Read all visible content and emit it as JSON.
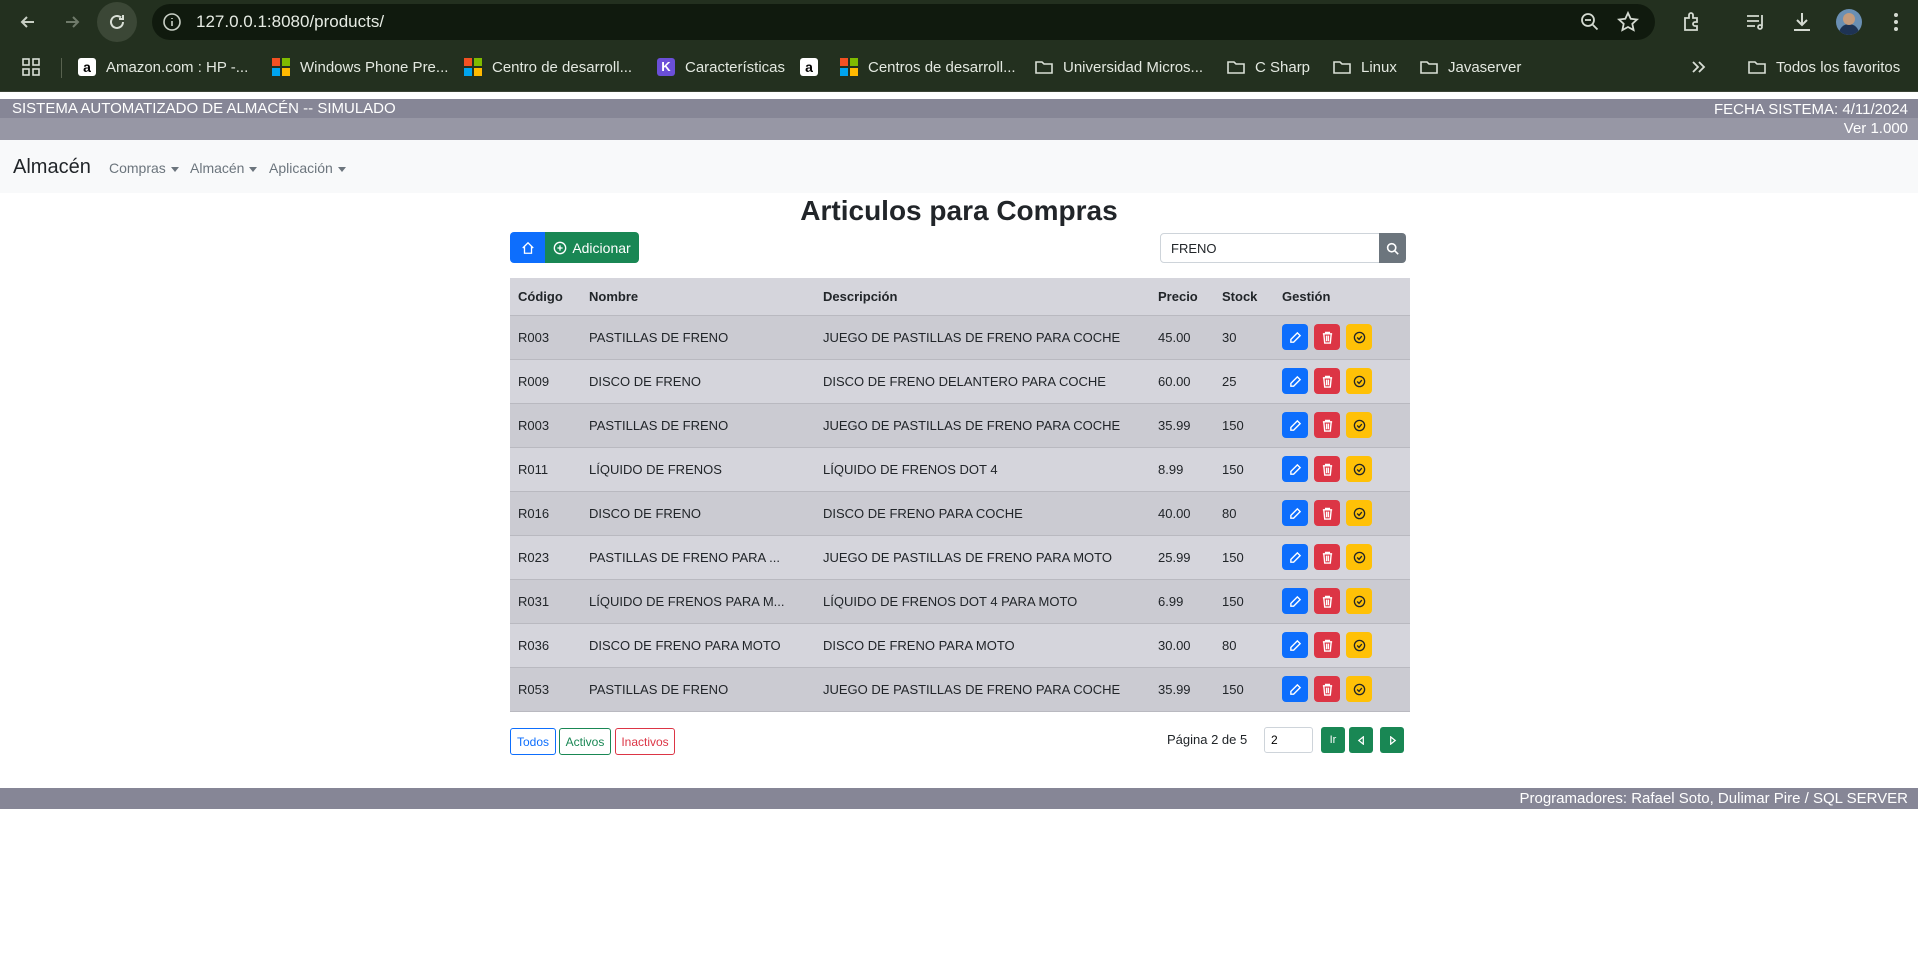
{
  "browser": {
    "url": "127.0.0.1:8080/products/",
    "bookmarks": [
      {
        "label": "Amazon.com : HP -...",
        "icon": "amazon-icon"
      },
      {
        "label": "Windows Phone Pre...",
        "icon": "microsoft-icon"
      },
      {
        "label": "Centro de desarroll...",
        "icon": "microsoft-icon"
      },
      {
        "label": "Características",
        "icon": "k-icon"
      },
      {
        "label": "",
        "icon": "amazon-icon"
      },
      {
        "label": "Centros de desarroll...",
        "icon": "microsoft-icon"
      },
      {
        "label": "Universidad Micros...",
        "icon": "folder-icon"
      },
      {
        "label": "C Sharp",
        "icon": "folder-icon"
      },
      {
        "label": "Linux",
        "icon": "folder-icon"
      },
      {
        "label": "Javaserver",
        "icon": "folder-icon"
      }
    ],
    "all_bookmarks": "Todos los favoritos"
  },
  "header": {
    "system_title": "SISTEMA AUTOMATIZADO DE ALMACÉN -- SIMULADO",
    "date": "FECHA SISTEMA: 4/11/2024",
    "version": "Ver 1.000"
  },
  "navbar": {
    "brand": "Almacén",
    "menus": [
      "Compras",
      "Almacén",
      "Aplicación"
    ]
  },
  "page": {
    "title": "Articulos para Compras",
    "add_label": "Adicionar",
    "search_value": "FRENO"
  },
  "table": {
    "columns": [
      "Código",
      "Nombre",
      "Descripción",
      "Precio",
      "Stock",
      "Gestión"
    ],
    "rows": [
      {
        "code": "R003",
        "name": "PASTILLAS DE FRENO",
        "desc": "JUEGO DE PASTILLAS DE FRENO PARA COCHE",
        "price": "45.00",
        "stock": "30"
      },
      {
        "code": "R009",
        "name": "DISCO DE FRENO",
        "desc": "DISCO DE FRENO DELANTERO PARA COCHE",
        "price": "60.00",
        "stock": "25"
      },
      {
        "code": "R003",
        "name": "PASTILLAS DE FRENO",
        "desc": "JUEGO DE PASTILLAS DE FRENO PARA COCHE",
        "price": "35.99",
        "stock": "150"
      },
      {
        "code": "R011",
        "name": "LÍQUIDO DE FRENOS",
        "desc": "LÍQUIDO DE FRENOS DOT 4",
        "price": "8.99",
        "stock": "150"
      },
      {
        "code": "R016",
        "name": "DISCO DE FRENO",
        "desc": "DISCO DE FRENO PARA COCHE",
        "price": "40.00",
        "stock": "80"
      },
      {
        "code": "R023",
        "name": "PASTILLAS DE FRENO PARA ...",
        "desc": "JUEGO DE PASTILLAS DE FRENO PARA MOTO",
        "price": "25.99",
        "stock": "150"
      },
      {
        "code": "R031",
        "name": "LÍQUIDO DE FRENOS PARA M...",
        "desc": "LÍQUIDO DE FRENOS DOT 4 PARA MOTO",
        "price": "6.99",
        "stock": "150"
      },
      {
        "code": "R036",
        "name": "DISCO DE FRENO PARA MOTO",
        "desc": "DISCO DE FRENO PARA MOTO",
        "price": "30.00",
        "stock": "80"
      },
      {
        "code": "R053",
        "name": "PASTILLAS DE FRENO",
        "desc": "JUEGO DE PASTILLAS DE FRENO PARA COCHE",
        "price": "35.99",
        "stock": "150"
      }
    ]
  },
  "filters": {
    "all": "Todos",
    "active": "Activos",
    "inactive": "Inactivos"
  },
  "pagination": {
    "info": "Página 2 de 5",
    "page_value": "2",
    "go_label": "Ir"
  },
  "footer": {
    "credits": "Programadores: Rafael Soto, Dulimar Pire / SQL SERVER"
  },
  "colors": {
    "primary": "#0d6efd",
    "success": "#198754",
    "danger": "#dc3545",
    "warning": "#ffc107",
    "header_bar": "#868696"
  }
}
